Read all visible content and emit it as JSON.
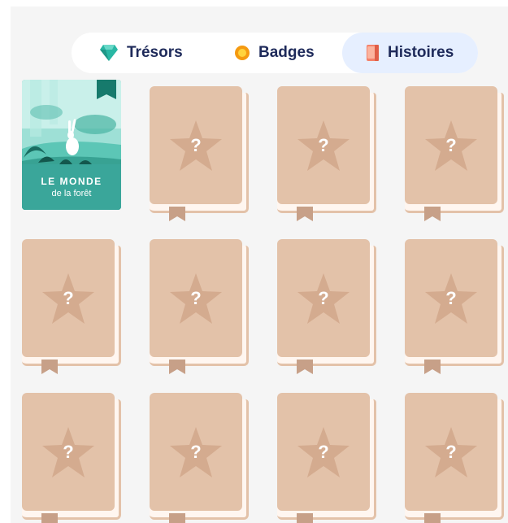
{
  "tabs": [
    {
      "label": "Trésors",
      "icon": "gem-icon",
      "active": false
    },
    {
      "label": "Badges",
      "icon": "coin-badge-icon",
      "active": false
    },
    {
      "label": "Histoires",
      "icon": "book-icon",
      "active": true
    }
  ],
  "story": {
    "title_line1": "LE MONDE",
    "title_line2": "de la forêt",
    "unlocked": true
  },
  "locked_book": {
    "mark": "?"
  },
  "colors": {
    "accent_text": "#1e2a5a",
    "active_tab_bg": "#e6efff",
    "locked_cover": "#e3c2a9",
    "locked_star": "#d4ab8f",
    "ribbon": "#c7a088",
    "story_teal": "#3aa69a",
    "gem": "#29b7a4",
    "coin": "#f59a10",
    "book_icon": "#f4816a"
  }
}
